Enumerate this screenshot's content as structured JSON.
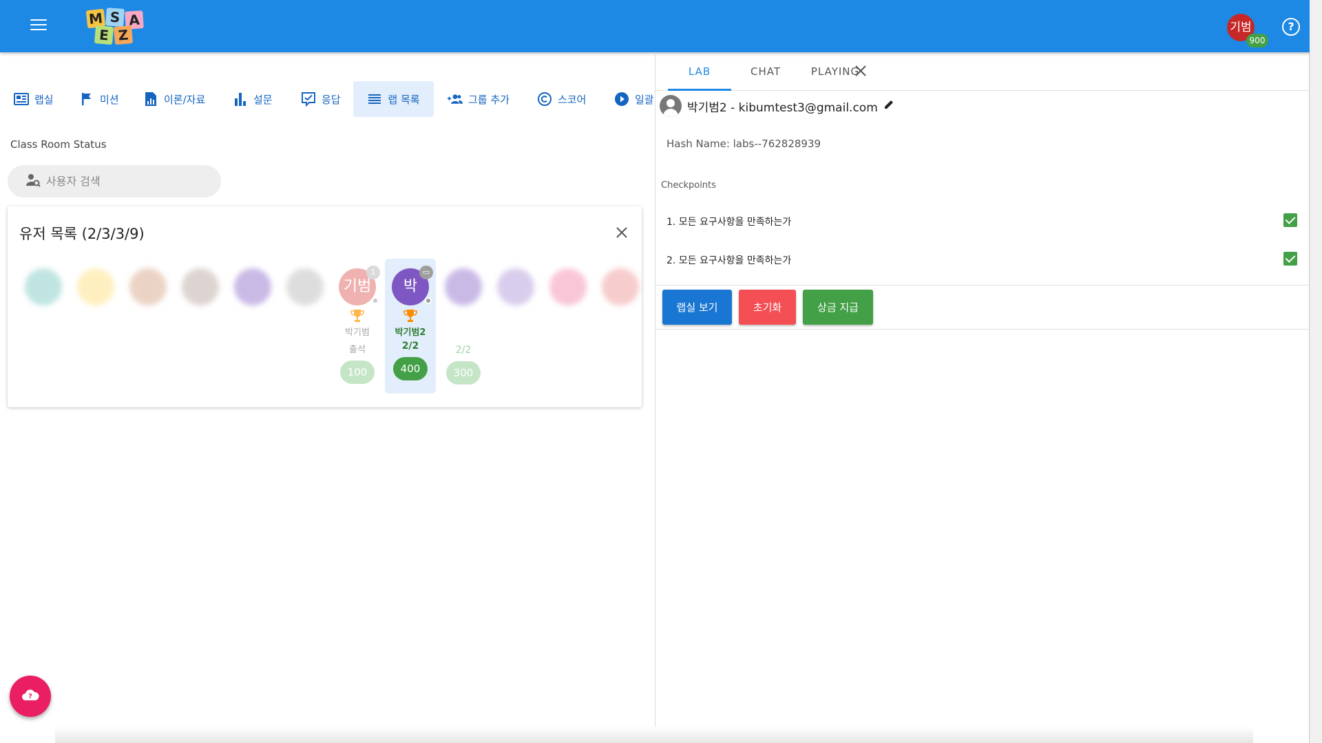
{
  "header": {
    "hamburger_icon": "menu-icon",
    "logo_letters": [
      "M",
      "S",
      "A",
      "E",
      "Z"
    ],
    "user_avatar": "기범",
    "user_points": "900",
    "help_icon": "help-circle-icon"
  },
  "toolbar": {
    "items": [
      {
        "label": "랩실",
        "icon": "lab-icon"
      },
      {
        "label": "미션",
        "icon": "flag-icon"
      },
      {
        "label": "이론/자료",
        "icon": "document-icon"
      },
      {
        "label": "설문",
        "icon": "bar-chart-icon"
      },
      {
        "label": "응답",
        "icon": "check-box-icon"
      },
      {
        "label": "랩 목록",
        "icon": "list-icon"
      },
      {
        "label": "그룹 추가",
        "icon": "group-add-icon"
      },
      {
        "label": "스코어",
        "icon": "copyright-icon"
      },
      {
        "label": "일괄",
        "icon": "play-circle-icon"
      }
    ],
    "active_index": 5
  },
  "main": {
    "section_title": "Class Room Status",
    "search": {
      "placeholder": "사용자 검색"
    },
    "user_list": {
      "title": "유저 목록 (2/3/3/9)",
      "users": [
        {
          "avatar": "박",
          "name": "박기범",
          "sub": "출석",
          "score": "100",
          "badge": "1",
          "avatar_color": "#e57373",
          "score_color": "#81c784"
        },
        {
          "avatar": "박",
          "name": "박기범2",
          "fraction": "2/2",
          "score": "400",
          "avatar_color": "#7e57c2",
          "score_color": "#43a047"
        },
        {
          "fraction": "2/2",
          "score": "300",
          "score_color": "#81c784"
        }
      ],
      "first_user_avatar": "기범"
    }
  },
  "panel": {
    "tabs": [
      "LAB",
      "CHAT",
      "PLAYING"
    ],
    "active_tab": 0,
    "user_line": "박기범2 - kibumtest3@gmail.com",
    "hash_name": "Hash Name: labs--762828939",
    "checkpoints_label": "Checkpoints",
    "checkpoints": [
      {
        "label": "1. 모든 요구사항을 만족하는가",
        "checked": true
      },
      {
        "label": "2. 모든 요구사항을 만족하는가",
        "checked": true
      }
    ],
    "buttons": {
      "view_lab": {
        "label": "랩실 보기",
        "color": "#1976d2"
      },
      "reset": {
        "label": "초기화",
        "color": "#f44f55"
      },
      "award": {
        "label": "상금 지급",
        "color": "#43a047"
      }
    }
  },
  "colors": {
    "primary": "#1e88e5",
    "fab": "#e91e63",
    "success": "#43a047"
  }
}
